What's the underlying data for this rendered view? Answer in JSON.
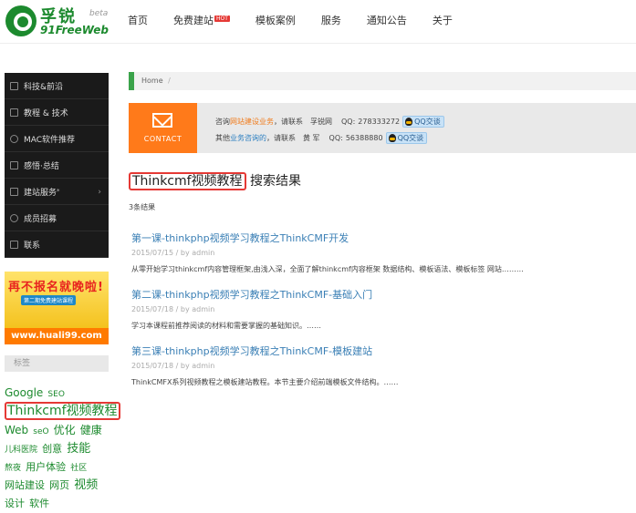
{
  "header": {
    "logo_cn": "孚锐",
    "logo_en": "91FreeWeb",
    "logo_beta": "beta",
    "nav": [
      "首页",
      "免费建站",
      "模板案例",
      "服务",
      "通知公告",
      "关于"
    ],
    "nav_badge": "HOT"
  },
  "sidebar": {
    "items": [
      {
        "label": "科技&前沿",
        "icon": "document-icon"
      },
      {
        "label": "教程 & 技术",
        "icon": "terminal-icon"
      },
      {
        "label": "MAC软件推荐",
        "icon": "info-icon"
      },
      {
        "label": "感悟·总结",
        "icon": "image-icon"
      },
      {
        "label": "建站服务",
        "icon": "monitor-icon",
        "sup": "*",
        "arrow": "›"
      },
      {
        "label": "成员招募",
        "icon": "chat-icon"
      },
      {
        "label": "联系",
        "icon": "phone-icon"
      }
    ],
    "banner": {
      "title": "再不报名就晚啦!",
      "sub": "第二期免费建站课程",
      "url": "www.huali99.com"
    },
    "tags_heading": "标签",
    "tags": [
      {
        "text": "Google",
        "size": 12
      },
      {
        "text": "SEO",
        "size": 9
      },
      {
        "text": "Thinkcmf视频教程",
        "size": 14,
        "highlight": true
      },
      {
        "text": "Web",
        "size": 12
      },
      {
        "text": "seO",
        "size": 9
      },
      {
        "text": "优化",
        "size": 12
      },
      {
        "text": "健康",
        "size": 12
      },
      {
        "text": "儿科医院",
        "size": 9
      },
      {
        "text": "创意",
        "size": 11
      },
      {
        "text": "技能",
        "size": 13
      },
      {
        "text": "熬夜",
        "size": 9
      },
      {
        "text": "用户体验",
        "size": 11
      },
      {
        "text": "社区",
        "size": 9
      },
      {
        "text": "网站建设",
        "size": 11
      },
      {
        "text": "网页",
        "size": 11
      },
      {
        "text": "视频",
        "size": 13
      },
      {
        "text": "设计",
        "size": 11
      },
      {
        "text": "软件",
        "size": 11
      }
    ]
  },
  "breadcrumb": {
    "home": "Home",
    "sep": "/"
  },
  "contact": {
    "button_label": "CONTACT",
    "line1": {
      "pre": "咨询",
      "link": "网站建设业务",
      "mid": "，请联系",
      "name": "孚锐网",
      "qq_label": "QQ:",
      "qq": "278333272",
      "btn": "QQ交谈"
    },
    "line2": {
      "pre": "其他",
      "link": "业务咨询的",
      "mid": "，请联系",
      "name": "黄 军",
      "qq_label": "QQ:",
      "qq": "56388880",
      "btn": "QQ交谈"
    }
  },
  "search": {
    "query": "Thinkcmf视频教程",
    "suffix": "搜索结果",
    "count": "3条结果"
  },
  "results": [
    {
      "title": "第一课-thinkphp视频学习教程之ThinkCMF开发",
      "meta": "2015/07/15 / by admin",
      "excerpt": "从零开始学习thinkcmf内容管理框架,由浅入深，全面了解thinkcmf内容框架 数据结构、模板语法、模板标签 网站………"
    },
    {
      "title": "第二课-thinkphp视频学习教程之ThinkCMF-基础入门",
      "meta": "2015/07/18 / by admin",
      "excerpt": "学习本课程前推荐阅读的材料和需要掌握的基础知识。……"
    },
    {
      "title": "第三课-thinkphp视频学习教程之ThinkCMF-模板建站",
      "meta": "2015/07/18 / by admin",
      "excerpt": "ThinkCMFX系列视频教程之模板建站教程。本节主要介绍前端模板文件结构。……"
    }
  ],
  "colors": {
    "brand_green": "#1c8a2e",
    "highlight_red": "#e53935",
    "contact_orange": "#ff7a1a",
    "link_blue": "#3a7fb5"
  }
}
